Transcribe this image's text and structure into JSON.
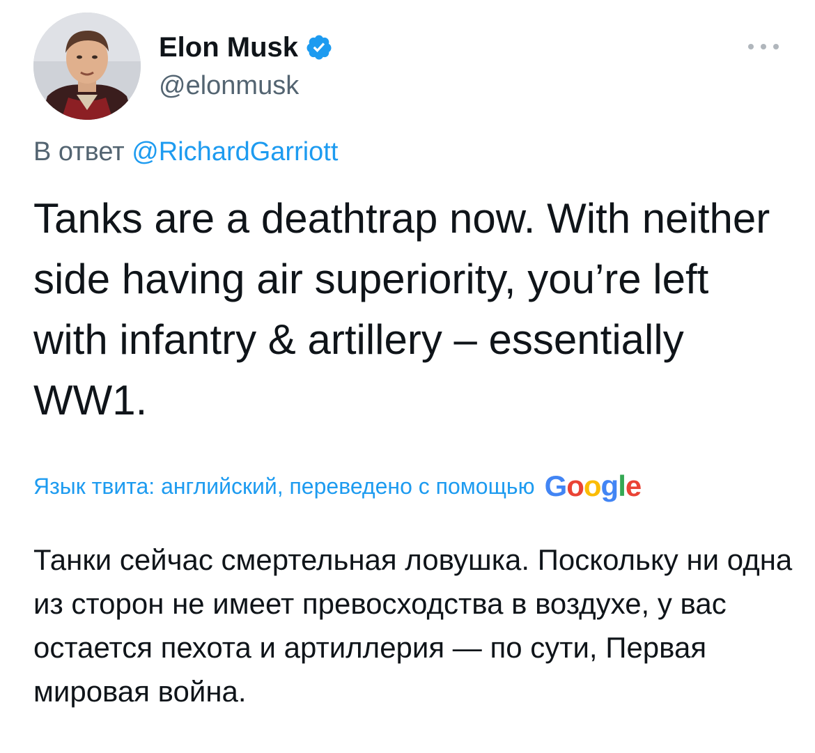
{
  "tweet": {
    "author_name": "Elon Musk",
    "author_handle": "@elonmusk",
    "verified": true,
    "verified_icon": "verified-badge-icon",
    "more_icon": "more-options-icon",
    "reply_prefix": "В ответ",
    "reply_mention": "@RichardGarriott",
    "text": "Tanks are a deathtrap now. With neither side having air superiority, you’re left with infantry & artillery – essentially WW1.",
    "translation_label": "Язык твита: английский, переведено с помощью",
    "translation_provider": "Google",
    "translated_text": "Танки сейчас смертельная ловушка. Поскольку ни одна из сторон не имеет превосходства в воздухе, у вас остается пехота и артиллерия — по сути, Первая мировая война."
  },
  "colors": {
    "accent": "#1d9bf0",
    "secondary_text": "#536471",
    "primary_text": "#0f1419",
    "google_blue": "#4285f4",
    "google_red": "#ea4335",
    "google_yellow": "#fbbc05",
    "google_green": "#34a853"
  }
}
